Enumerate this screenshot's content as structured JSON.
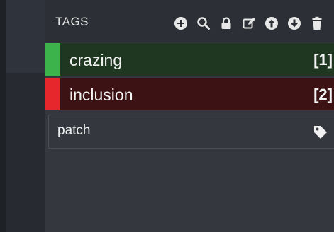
{
  "panel": {
    "title": "TAGS",
    "toolbar": [
      {
        "name": "add-icon"
      },
      {
        "name": "search-icon"
      },
      {
        "name": "lock-icon"
      },
      {
        "name": "edit-icon"
      },
      {
        "name": "move-up-icon"
      },
      {
        "name": "move-down-icon"
      },
      {
        "name": "delete-icon"
      }
    ]
  },
  "tags": [
    {
      "label": "crazing",
      "count": "[1]",
      "color": "#3cb44b"
    },
    {
      "label": "inclusion",
      "count": "[2]",
      "color": "#e6282d"
    }
  ],
  "input": {
    "value": "patch",
    "icon": "tag-icon"
  }
}
